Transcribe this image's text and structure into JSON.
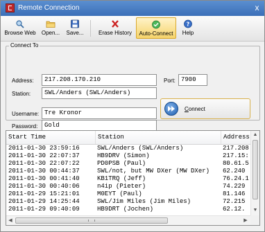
{
  "window": {
    "title": "Remote Connection",
    "close_glyph": "x"
  },
  "toolbar": {
    "buttons": [
      {
        "label": "Browse Web",
        "icon": "magnifier-icon",
        "active": false
      },
      {
        "label": "Open...",
        "icon": "folder-icon",
        "active": false
      },
      {
        "label": "Save...",
        "icon": "floppy-disk-icon",
        "active": false
      },
      {
        "label": "Erase History",
        "icon": "red-x-icon",
        "active": false
      },
      {
        "label": "Auto-Connect",
        "icon": "green-check-icon",
        "active": true
      },
      {
        "label": "Help",
        "icon": "help-icon",
        "active": false
      }
    ]
  },
  "connect_to": {
    "legend": "Connect To",
    "address_label": "Address:",
    "address_value": "217.208.170.210",
    "port_label": "Port:",
    "port_value": "7900",
    "station_label": "Station:",
    "station_value": "SWL/Anders (SWL/Anders)",
    "username_label": "Username:",
    "username_value": "Tre Kronor",
    "password_label": "Password:",
    "password_value": "Gold",
    "connect_label": "Connect"
  },
  "history": {
    "columns": [
      "Start Time",
      "Station",
      "Address"
    ],
    "rows": [
      {
        "time": "2011-01-30 23:59:16",
        "station": "SWL/Anders (SWL/Anders)",
        "address": "217.208"
      },
      {
        "time": "2011-01-30 22:07:37",
        "station": "HB9DRV (Simon)",
        "address": "217.15:"
      },
      {
        "time": "2011-01-30 22:07:22",
        "station": "PD0PSB (Paul)",
        "address": "80.61.5"
      },
      {
        "time": "2011-01-30 00:44:37",
        "station": "SWL/not, but MW DXer (MW DXer)",
        "address": "62.240"
      },
      {
        "time": "2011-01-30 00:41:40",
        "station": "KB1TRQ (Jeff)",
        "address": "76.24.1"
      },
      {
        "time": "2011-01-30 00:40:06",
        "station": "n4ip (Pieter)",
        "address": "74.229"
      },
      {
        "time": "2011-01-29 15:21:01",
        "station": "M0EYT (Paul)",
        "address": "81.146"
      },
      {
        "time": "2011-01-29 14:25:44",
        "station": "SWL/Jim Miles (Jim Miles)",
        "address": "72.215"
      },
      {
        "time": "2011-01-29 09:40:09",
        "station": "HB9DRT (Jochen)",
        "address": "62.12."
      }
    ]
  },
  "colors": {
    "title_bar": "#3b6fb8",
    "active_button": "#f5d36a",
    "erase_icon": "#cc2222",
    "check_icon": "#3aa34a"
  }
}
